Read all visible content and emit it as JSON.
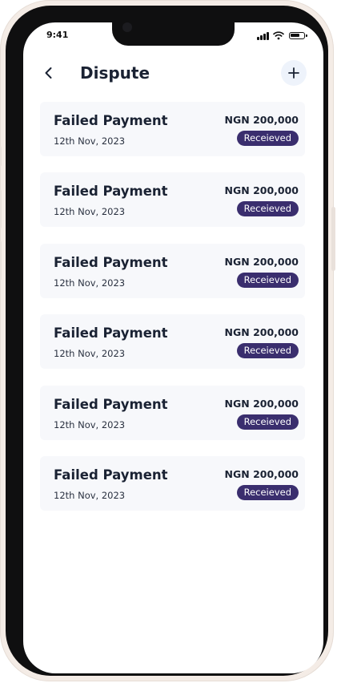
{
  "status_bar": {
    "time": "9:41",
    "icons": [
      "signal-icon",
      "wifi-icon",
      "battery-icon"
    ]
  },
  "header": {
    "back_icon": "chevron-left-icon",
    "title": "Dispute",
    "add_icon": "plus-icon"
  },
  "colors": {
    "title_text": "#1a2233",
    "card_background": "#f7f8fb",
    "badge_background": "#3a2e6e",
    "add_button_background": "#eef3fb"
  },
  "disputes": [
    {
      "title": "Failed Payment",
      "date": "12th Nov, 2023",
      "amount": "NGN 200,000",
      "status": "Receieved"
    },
    {
      "title": "Failed Payment",
      "date": "12th Nov, 2023",
      "amount": "NGN 200,000",
      "status": "Receieved"
    },
    {
      "title": "Failed Payment",
      "date": "12th Nov, 2023",
      "amount": "NGN 200,000",
      "status": "Receieved"
    },
    {
      "title": "Failed Payment",
      "date": "12th Nov, 2023",
      "amount": "NGN 200,000",
      "status": "Receieved"
    },
    {
      "title": "Failed Payment",
      "date": "12th Nov, 2023",
      "amount": "NGN 200,000",
      "status": "Receieved"
    },
    {
      "title": "Failed Payment",
      "date": "12th Nov, 2023",
      "amount": "NGN 200,000",
      "status": "Receieved"
    }
  ]
}
